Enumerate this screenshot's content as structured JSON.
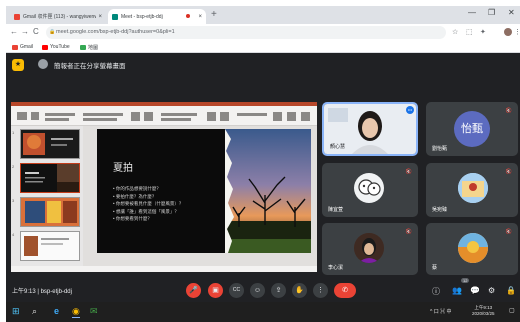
{
  "browser": {
    "tabs": [
      {
        "label": "Gmail 収件匣 (113) - wangyiwenwjb@gmail.com",
        "fav_color": "#ea4335",
        "close": "×"
      },
      {
        "label": "Meet - bsp-etjb-ddj",
        "fav_color": "#00897b",
        "close": "×"
      }
    ],
    "new_tab": "+",
    "window": {
      "minimize": "—",
      "maximize": "❐",
      "close": "✕"
    },
    "nav": {
      "back": "←",
      "forward": "→",
      "reload": "C",
      "home": "⌂"
    },
    "url": "meet.google.com/bsp-etjb-ddj?authuser=0&pli=1",
    "lock": "🔒",
    "toolbar_icons": [
      "☆",
      "⬚",
      "✦",
      "⋮"
    ],
    "bookmarks": [
      {
        "label": "Gmail",
        "color": "#ea4335"
      },
      {
        "label": "YouTube",
        "color": "#ff0000"
      },
      {
        "label": "地圖",
        "color": "#34a853"
      }
    ]
  },
  "meet": {
    "badge": "★",
    "title": "簡報者正在分享螢幕畫面",
    "slide": {
      "title": "夏拍",
      "bullets": [
        "你的作品想要說什麼？",
        "要拍什麼？為什麼？",
        "你想要被看見什麼（什麼風景）？",
        "想讓「誰」看到這個「風景」？",
        "你想要看到什麼？"
      ]
    },
    "thumb_numbers": [
      "1",
      "2",
      "3",
      "4"
    ],
    "participants": [
      {
        "name": "顏心慧",
        "type": "video"
      },
      {
        "name": "劉怡甄",
        "initials": "怡甄",
        "type": "initials"
      },
      {
        "name": "陳宜萱",
        "type": "avatar"
      },
      {
        "name": "吳宛臻",
        "type": "avatar"
      },
      {
        "name": "李心潔",
        "type": "avatar"
      },
      {
        "name": "蔡",
        "type": "avatar"
      }
    ],
    "mic_off": "🔇",
    "clock": "上午9:13",
    "meeting_code": "bsp-etjb-ddj",
    "controls": {
      "mic": "🎤",
      "camera": "▣",
      "captions": "CC",
      "emoji": "☺",
      "present": "⇪",
      "raise_hand": "✋",
      "more": "⋮",
      "end_call": "✆"
    },
    "right_controls": {
      "info": "ⓘ",
      "people": "👥",
      "chat": "💬",
      "activities": "⚙",
      "lock": "🔒"
    },
    "people_count": "12"
  },
  "taskbar": {
    "start": "⊞",
    "search": "⌕",
    "apps": [
      "e",
      "◉",
      "✉"
    ],
    "tray": "^ 口 ⌘ 中",
    "time": "上午9:13",
    "date": "2020/03/25",
    "notif": "▢"
  }
}
